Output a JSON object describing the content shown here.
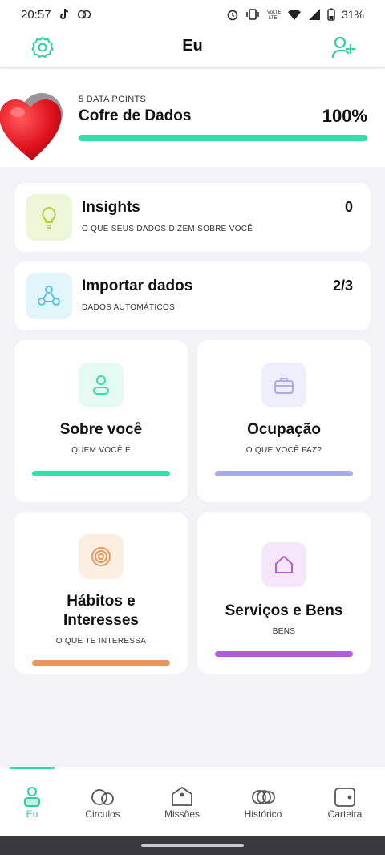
{
  "status_bar": {
    "time": "20:57",
    "battery": "31%",
    "icons": [
      "tiktok-icon",
      "notification-icon",
      "alarm-icon",
      "vibrate-icon",
      "volte-icon",
      "wifi-icon",
      "signal-icon",
      "battery-icon"
    ]
  },
  "header": {
    "title": "Eu",
    "left_icon": "settings-icon",
    "right_icon": "add-user-icon"
  },
  "vault": {
    "data_points_label": "5 DATA POINTS",
    "title": "Cofre de Dados",
    "percent_label": "100%",
    "progress": 1.0,
    "avatar": "heart-emoji"
  },
  "insights": {
    "title": "Insights",
    "subtitle": "O QUE SEUS DADOS DIZEM SOBRE VOCÊ",
    "value": "0",
    "icon": "lightbulb-icon"
  },
  "import": {
    "title": "Importar dados",
    "subtitle": "DADOS AUTOMÁTICOS",
    "value": "2/3",
    "icon": "network-icon"
  },
  "grid": [
    {
      "title": "Sobre você",
      "subtitle": "QUEM VOCÊ É",
      "icon": "person-icon",
      "color": "#33dfa8",
      "bg": "#e4faf2"
    },
    {
      "title": "Ocupação",
      "subtitle": "O QUE VOCÊ FAZ?",
      "icon": "briefcase-icon",
      "color": "#a7abe8",
      "bg": "#eeeffb"
    },
    {
      "title_line1": "Hábitos e",
      "title_line2": "Interesses",
      "subtitle": "O QUE TE INTERESSA",
      "icon": "target-icon",
      "color": "#e8965c",
      "bg": "#fdeee2"
    },
    {
      "title": "Serviços e Bens",
      "subtitle": "BENS",
      "icon": "house-icon",
      "color": "#b05fd0",
      "bg": "#f5e6f9"
    }
  ],
  "nav": [
    {
      "label": "Eu",
      "icon": "person-icon",
      "active": true
    },
    {
      "label": "Circulos",
      "icon": "circles-icon"
    },
    {
      "label": "Missões",
      "icon": "missions-icon"
    },
    {
      "label": "Histórico",
      "icon": "history-icon"
    },
    {
      "label": "Carteira",
      "icon": "wallet-icon"
    }
  ],
  "colors": {
    "accent": "#33dfa8",
    "background": "#f3f2f4"
  }
}
